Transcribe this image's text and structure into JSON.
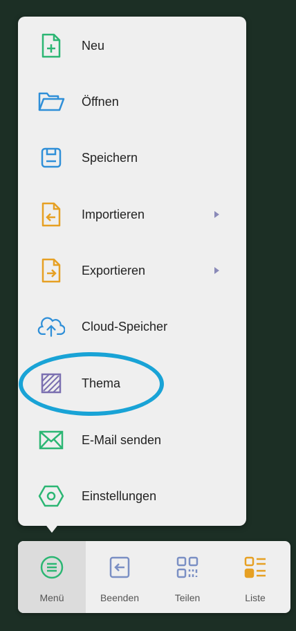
{
  "menu": {
    "items": [
      {
        "id": "new",
        "label": "Neu",
        "icon": "new-file-icon",
        "color": "#2bb673"
      },
      {
        "id": "open",
        "label": "Öffnen",
        "icon": "folder-open-icon",
        "color": "#2f8fd8"
      },
      {
        "id": "save",
        "label": "Speichern",
        "icon": "save-icon",
        "color": "#2f8fd8"
      },
      {
        "id": "import",
        "label": "Importieren",
        "icon": "import-icon",
        "color": "#e6a023",
        "submenu": true
      },
      {
        "id": "export",
        "label": "Exportieren",
        "icon": "export-icon",
        "color": "#e6a023",
        "submenu": true
      },
      {
        "id": "cloud",
        "label": "Cloud-Speicher",
        "icon": "cloud-upload-icon",
        "color": "#2f8fd8"
      },
      {
        "id": "theme",
        "label": "Thema",
        "icon": "theme-icon",
        "color": "#7a6fb0"
      },
      {
        "id": "email",
        "label": "E-Mail senden",
        "icon": "mail-icon",
        "color": "#2bb673"
      },
      {
        "id": "settings",
        "label": "Einstellungen",
        "icon": "settings-icon",
        "color": "#2bb673"
      }
    ]
  },
  "toolbar": {
    "items": [
      {
        "id": "menu",
        "label": "Menü",
        "icon": "menu-icon",
        "active": true
      },
      {
        "id": "exit",
        "label": "Beenden",
        "icon": "exit-icon"
      },
      {
        "id": "share",
        "label": "Teilen",
        "icon": "qr-code-icon"
      },
      {
        "id": "list",
        "label": "Liste",
        "icon": "list-icon"
      }
    ]
  },
  "colors": {
    "background": "#1c2f25",
    "panel": "#efefef",
    "highlight_ring": "#19a3d6",
    "menu_active": "#dcdcdc"
  }
}
